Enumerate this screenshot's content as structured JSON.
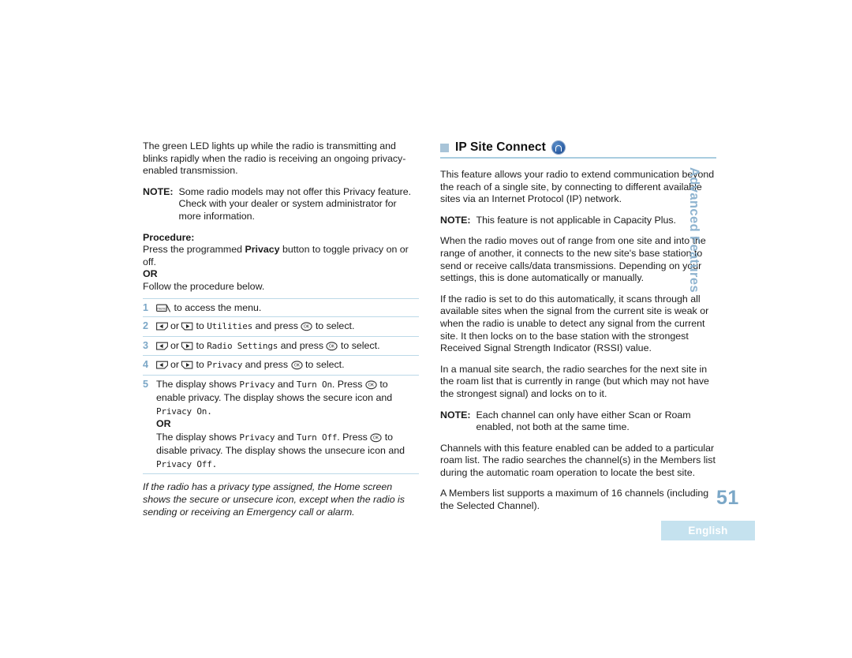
{
  "document": {
    "page_number": "51",
    "language_badge": "English",
    "side_tab": "Advanced Features"
  },
  "left_column": {
    "intro_paragraph": "The green LED lights up while the radio is transmitting and blinks rapidly when the radio is receiving an ongoing privacy-enabled transmission.",
    "note": {
      "label": "NOTE:",
      "text": "Some radio models may not offer this Privacy feature. Check with your dealer or system administrator for more information."
    },
    "procedure_heading": "Procedure:",
    "procedure_intro_pre": "Press the programmed ",
    "procedure_intro_bold": "Privacy",
    "procedure_intro_post": " button to toggle privacy on or off.",
    "or_label": "OR",
    "follow_text": "Follow the procedure below.",
    "steps": [
      {
        "num": "1",
        "icon": "menu-key-icon",
        "text_after_icon": " to access the menu."
      },
      {
        "num": "2",
        "icon_left": "left-arrow-key-icon",
        "or_word": "or",
        "icon_right": "right-arrow-key-icon",
        "text_mid": " to ",
        "lcd_1": "Utilities",
        "text_after": " and press ",
        "icon_ok": "ok-key-icon",
        "text_end": " to select."
      },
      {
        "num": "3",
        "icon_left": "left-arrow-key-icon",
        "or_word": "or",
        "icon_right": "right-arrow-key-icon",
        "text_mid": " to ",
        "lcd_1": "Radio Settings",
        "text_after": " and press ",
        "icon_ok": "ok-key-icon",
        "text_end": " to select."
      },
      {
        "num": "4",
        "icon_left": "left-arrow-key-icon",
        "or_word": "or",
        "icon_right": "right-arrow-key-icon",
        "text_mid": " to ",
        "lcd_1": "Privacy",
        "text_after": " and press ",
        "icon_ok": "ok-key-icon",
        "text_end": " to select."
      },
      {
        "num": "5",
        "p1_a": "The display shows ",
        "p1_lcd1": "Privacy",
        "p1_b": " and ",
        "p1_lcd2": "Turn On",
        "p1_c": ". Press ",
        "p1_d": " to enable privacy. The display shows the secure icon and ",
        "p1_lcd3": "Privacy On.",
        "or_label": "OR",
        "p2_a": "The display shows ",
        "p2_lcd1": "Privacy",
        "p2_b": " and ",
        "p2_lcd2": "Turn Off",
        "p2_c": ". Press ",
        "p2_d": " to disable privacy. The display shows the unsecure icon and ",
        "p2_lcd3": "Privacy Off."
      }
    ],
    "italic_note": "If the radio has a privacy type assigned, the Home screen shows the secure or unsecure icon, except when the radio is sending or receiving an Emergency call or alarm."
  },
  "right_column": {
    "heading": "IP Site Connect",
    "heading_icon": "ip-site-connect-icon",
    "paragraph_1": "This feature allows your radio to extend communication beyond the reach of a single site, by connecting to different available sites via an Internet Protocol (IP) network.",
    "note_1": {
      "label": "NOTE:",
      "text": "This feature is not applicable in Capacity Plus."
    },
    "paragraph_2": "When the radio moves out of range from one site and into the range of another, it connects to the new site's base station to send or receive calls/data transmissions. Depending on your settings, this is done automatically or manually.",
    "paragraph_3": "If the radio is set to do this automatically, it scans through all available sites when the signal from the current site is weak or when the radio is unable to detect any signal from the current site. It then locks on to the base station with the strongest Received Signal Strength Indicator (RSSI) value.",
    "paragraph_4": "In a manual site search, the radio searches for the next site in the roam list that is currently in range (but which may not have the strongest signal) and locks on to it.",
    "note_2": {
      "label": "NOTE:",
      "text": "Each channel can only have either Scan or Roam enabled, not both at the same time."
    },
    "paragraph_5": "Channels with this feature enabled can be added to a particular roam list. The radio searches the channel(s) in the Members list during the automatic roam operation to locate the best site.",
    "paragraph_6": "A Members list supports a maximum of 16 channels (including the Selected Channel)."
  },
  "colors": {
    "accent_blue": "#7ba7c7",
    "rule_blue": "#bcd9e8",
    "badge_bg": "#c5e2ef",
    "bullet": "#a8c4d8"
  }
}
